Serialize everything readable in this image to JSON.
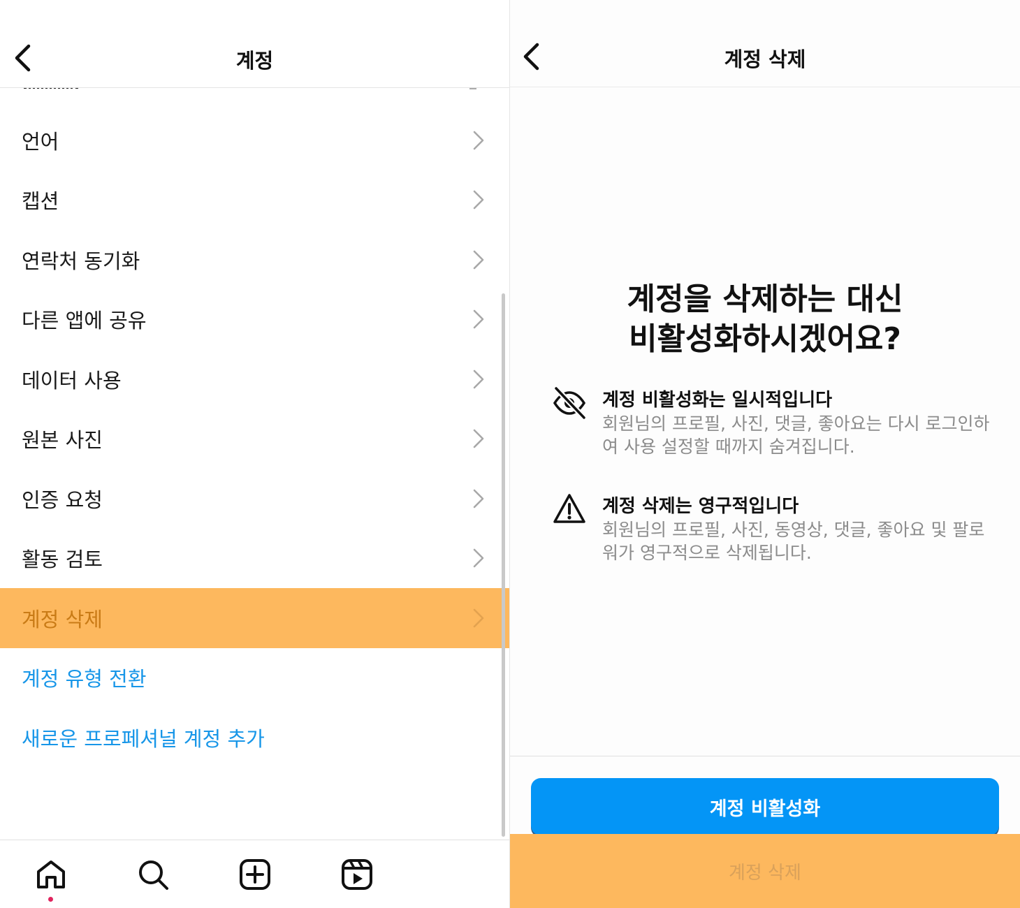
{
  "left": {
    "title": "계정",
    "menu_items": [
      {
        "label": "언어"
      },
      {
        "label": "캡션"
      },
      {
        "label": "연락처 동기화"
      },
      {
        "label": "다른 앱에 공유"
      },
      {
        "label": "데이터 사용"
      },
      {
        "label": "원본 사진"
      },
      {
        "label": "인증 요청"
      },
      {
        "label": "활동 검토"
      },
      {
        "label": "계정 삭제"
      }
    ],
    "links": [
      {
        "label": "계정 유형 전환"
      },
      {
        "label": "새로운 프로페셔널 계정 추가"
      }
    ],
    "tabbar": {
      "icons": [
        "home-icon",
        "search-icon",
        "create-post-icon",
        "reels-icon"
      ],
      "notification_dot_color": "#e0245e"
    }
  },
  "right": {
    "title": "계정 삭제",
    "heading_line1": "계정을 삭제하는 대신",
    "heading_line2": "비활성화하시겠어요?",
    "info": [
      {
        "icon": "eye-off-icon",
        "title": "계정 비활성화는 일시적입니다",
        "body": "회원님의 프로필, 사진, 댓글, 좋아요는 다시 로그인하여 사용 설정할 때까지 숨겨집니다."
      },
      {
        "icon": "warning-icon",
        "title": "계정 삭제는 영구적입니다",
        "body": "회원님의 프로필, 사진, 동영상, 댓글, 좋아요 및 팔로워가 영구적으로 삭제됩니다."
      }
    ],
    "primary_button": "계정 비활성화",
    "secondary_button": "계정 삭제"
  },
  "colors": {
    "highlight": "#fdb85e",
    "link": "#1796e8",
    "primary_button": "#0495f6"
  }
}
